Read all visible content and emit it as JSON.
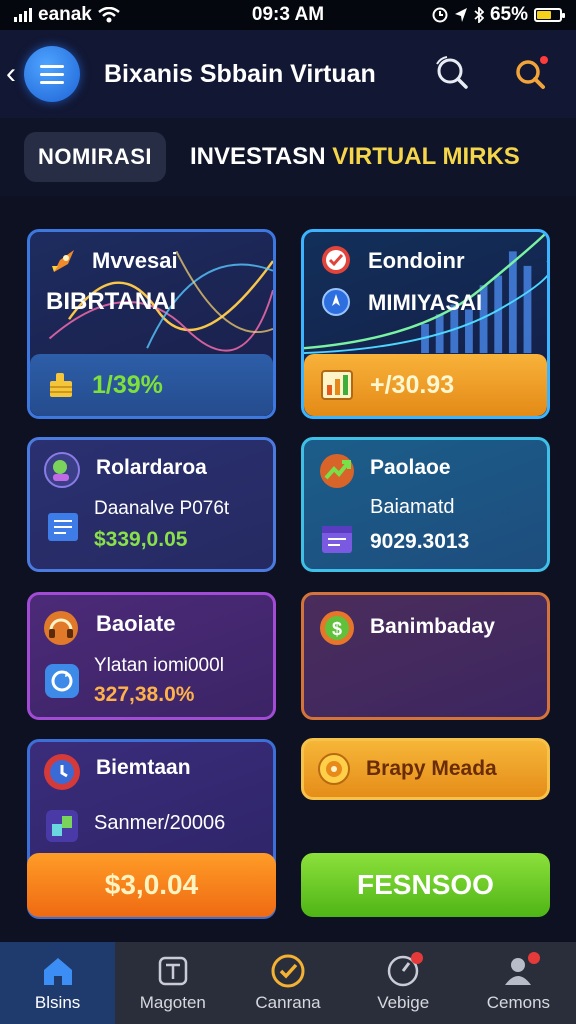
{
  "status_bar": {
    "carrier": "eanak",
    "time": "09:3 AM",
    "battery": "65%",
    "battery_level": 0.65
  },
  "header": {
    "title": "Bixanis Sbbain Virtuan",
    "icons": [
      "back-icon",
      "menu-icon",
      "search-icon",
      "notification-search-icon"
    ]
  },
  "tabs": {
    "chip": "NOMIRASI",
    "heading_main": "INVESTASN ",
    "heading_accent": "VIRTUAL MIRKS"
  },
  "cards": [
    {
      "title": "Mvvesai",
      "subtitle": "BIBRTANAI",
      "value": "1/39%",
      "value_color": "#7ee03a",
      "icon": "rocket-icon",
      "value_icon": "coin-stack-icon"
    },
    {
      "title": "Eondoinr",
      "subtitle": "MIMIYASAI",
      "value": "+/30.93",
      "value_color": "#fff7d0",
      "icon": "check-badge-icon",
      "sub_icon": "compass-icon",
      "value_icon": "bar-chart-icon"
    },
    {
      "title": "Rolardaroa",
      "text": "Daanalve P076t",
      "value": "$339,0.05",
      "value_color": "#8ae04a",
      "icon": "character-icon",
      "value_icon": "document-icon"
    },
    {
      "title": "Paolaoe",
      "text": "Baiamatd",
      "value": "9029.3013",
      "value_color": "#ffffff",
      "icon": "trend-arrow-icon",
      "value_icon": "calendar-icon"
    },
    {
      "title": "Baoiate",
      "text": "Ylatan iomi000l",
      "value": "327,38.0%",
      "value_color": "#ffb24a",
      "icon": "headset-icon",
      "value_icon": "refresh-icon"
    },
    {
      "title": "Banimbaday",
      "icon": "dollar-coin-icon"
    },
    {
      "title": "Biemtaan",
      "text": "Sanmer/20006",
      "icon": "time-icon",
      "value_icon": "puzzle-icon"
    }
  ],
  "buttons": {
    "orange_small": "Brapy Meada",
    "orange_big": "$3,0.04",
    "green_big": "FESNSOO"
  },
  "bottom_nav": [
    {
      "label": "Blsins",
      "icon": "home-icon",
      "active": true
    },
    {
      "label": "Magoten",
      "icon": "box-icon",
      "active": false
    },
    {
      "label": "Canrana",
      "icon": "check-circle-icon",
      "active": false
    },
    {
      "label": "Vebige",
      "icon": "chart-icon",
      "active": false
    },
    {
      "label": "Cemons",
      "icon": "user-icon",
      "active": false
    }
  ],
  "colors": {
    "background": "#0d1122",
    "accent_yellow": "#f5d64a",
    "accent_blue": "#2a7cf0",
    "positive_green": "#7ee03a"
  }
}
